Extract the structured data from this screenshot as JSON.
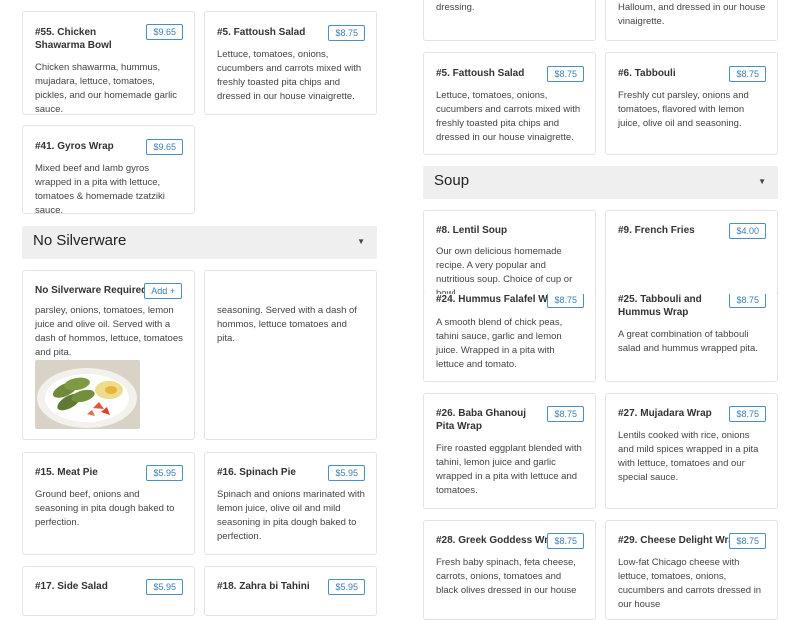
{
  "left_top": {
    "chicken_shawarma_bowl": {
      "title": "#55. Chicken Shawarma Bowl",
      "price": "$9.65",
      "desc": "Chicken shawarma, hummus, mujadara, lettuce, tomatoes, pickles, and our homemade garlic sauce."
    },
    "fattoush_salad": {
      "title": "#5. Fattoush Salad",
      "price": "$8.75",
      "desc": "Lettuce, tomatoes, onions, cucumbers and carrots mixed with freshly toasted pita chips and dressed in our house vinaigrette."
    },
    "gyros_wrap": {
      "title": "#41. Gyros Wrap",
      "price": "$9.65",
      "desc": "Mixed beef and lamb gyros wrapped in a pita with lettuce, tomatoes & homemade tzatziki sauce."
    }
  },
  "no_silverware_section": {
    "label": "No Silverware",
    "arrow": "▼"
  },
  "no_silverware_card": {
    "title": "No Silverware Required",
    "add_label": "Add +",
    "desc": "parsley, onions, tomatoes, lemon juice and olive oil. Served with a dash of hommos, lettuce, tomatoes and pita."
  },
  "hidden_card_right": {
    "desc": "seasoning. Served with a dash of hommos, lettuce tomatoes and pita."
  },
  "left_bottom": {
    "meat_pie": {
      "title": "#15. Meat Pie",
      "price": "$5.95",
      "desc": "Ground beef, onions and seasoning in pita dough baked to perfection."
    },
    "spinach_pie": {
      "title": "#16. Spinach Pie",
      "price": "$5.95",
      "desc": "Spinach and onions marinated with lemon juice, olive oil and mild seasoning in pita dough baked to perfection."
    },
    "side_salad": {
      "title": "#17. Side Salad",
      "price": "$5.95"
    },
    "zahra_bi_tahini": {
      "title": "#18. Zahra bi Tahini",
      "price": "$5.95"
    }
  },
  "right_top": {
    "partial_left_desc": "dressing.",
    "partial_right_desc": "Halloum, and dressed in our house vinaigrette.",
    "fattoush_salad": {
      "title": "#5. Fattoush Salad",
      "price": "$8.75",
      "desc": "Lettuce, tomatoes, onions, cucumbers and carrots mixed with freshly toasted pita chips and dressed in our house vinaigrette."
    },
    "tabbouli": {
      "title": "#6. Tabbouli",
      "price": "$8.75",
      "desc": "Freshly cut parsley, onions and tomatoes, flavored with lemon juice, olive oil and seasoning."
    }
  },
  "soup_section": {
    "label": "Soup",
    "arrow": "▼"
  },
  "right_bottom": {
    "lentil_soup": {
      "title": "#8. Lentil Soup",
      "desc": "Our own delicious homemade recipe. A very popular and nutritious soup. Choice of cup or bowl."
    },
    "french_fries": {
      "title": "#9. French Fries",
      "price": "$4.00"
    },
    "hummus_wrap": {
      "title": "#24. Hummus Falafel Wrap",
      "price": "$8.75",
      "desc": "A smooth blend of chick peas, tahini sauce, garlic and lemon juice. Wrapped in a pita with lettuce and tomato."
    },
    "tabbouli_hummus_wrap": {
      "title": "#25. Tabbouli and Hummus Wrap",
      "price": "$8.75",
      "desc": "A great combination of tabbouli salad and hummus wrapped pita."
    },
    "baba_ghanouj_wrap": {
      "title": "#26. Baba Ghanouj Pita Wrap",
      "price": "$8.75",
      "desc": "Fire roasted eggplant blended with tahini, lemon juice and garlic wrapped in a pita with lettuce and tomatoes."
    },
    "mujadara_wrap": {
      "title": "#27. Mujadara Wrap",
      "price": "$8.75",
      "desc": "Lentils cooked with rice, onions and mild spices wrapped in a pita with lettuce, tomatoes and our special sauce."
    },
    "greek_goddess_wrap": {
      "title": "#28. Greek Goddess Wrap",
      "price": "$8.75",
      "desc": "Fresh baby spinach, feta cheese, carrots, onions, tomatoes and black olives dressed in our house"
    },
    "cheese_delight_wrap": {
      "title": "#29. Cheese Delight Wrap",
      "price": "$8.75",
      "desc": "Low-fat Chicago cheese with lettuce, tomatoes, onions, cucumbers and carrots dressed in our house"
    }
  },
  "colors": {
    "accent": "#3a7fb5",
    "section_bg": "#efefef",
    "border": "#e3e3e3"
  },
  "images": {
    "food_photo": "grape-leaves-plate-photo"
  }
}
